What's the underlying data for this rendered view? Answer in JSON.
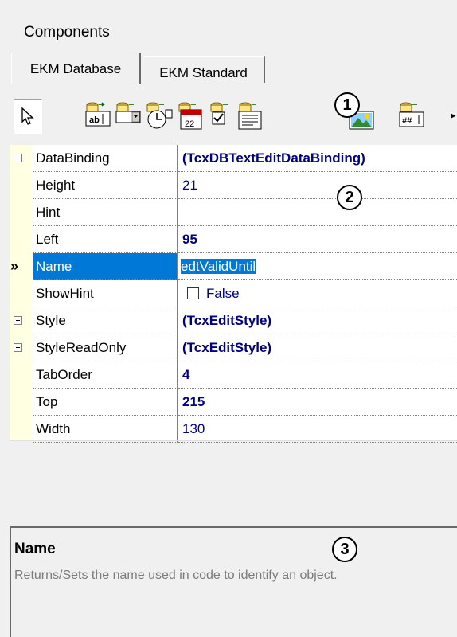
{
  "panel": {
    "title": "Components"
  },
  "tabs": [
    {
      "label": "EKM Database",
      "active": true
    },
    {
      "label": "EKM Standard",
      "active": false
    }
  ],
  "toolbar": {
    "items": [
      "pointer-icon",
      "db-text-edit-icon",
      "db-combo-icon",
      "db-time-icon",
      "db-date-icon",
      "db-checkbox-icon",
      "db-memo-icon",
      "db-image-icon",
      "db-numeric-edit-icon"
    ],
    "overflow": "▸"
  },
  "callouts": [
    "1",
    "2",
    "3"
  ],
  "properties": [
    {
      "name": "DataBinding",
      "value": "(TcxDBTextEditDataBinding)",
      "expandable": true,
      "bold": true
    },
    {
      "name": "Height",
      "value": "21",
      "expandable": false,
      "bold": false
    },
    {
      "name": "Hint",
      "value": "",
      "expandable": false,
      "bold": false
    },
    {
      "name": "Left",
      "value": "95",
      "expandable": false,
      "bold": true
    },
    {
      "name": "Name",
      "value": "edtValidUntil",
      "expandable": false,
      "bold": false,
      "selected": true
    },
    {
      "name": "ShowHint",
      "value": "False",
      "expandable": false,
      "bold": false,
      "checkbox": true
    },
    {
      "name": "Style",
      "value": "(TcxEditStyle)",
      "expandable": true,
      "bold": true
    },
    {
      "name": "StyleReadOnly",
      "value": "(TcxEditStyle)",
      "expandable": true,
      "bold": true
    },
    {
      "name": "TabOrder",
      "value": "4",
      "expandable": false,
      "bold": true
    },
    {
      "name": "Top",
      "value": "215",
      "expandable": false,
      "bold": true
    },
    {
      "name": "Width",
      "value": "130",
      "expandable": false,
      "bold": false
    }
  ],
  "selected_marker": "»",
  "description": {
    "title": "Name",
    "text": "Returns/Sets the name used in code to identify an object."
  },
  "colors": {
    "selection": "#0078d7",
    "value_text": "#000080",
    "gutter": "#ffffe1"
  }
}
